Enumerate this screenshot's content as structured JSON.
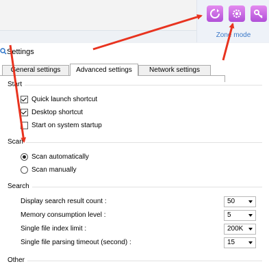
{
  "zone": {
    "label": "Zone mode",
    "buttons": [
      {
        "icon": "refresh-icon"
      },
      {
        "icon": "gear-icon"
      },
      {
        "icon": "key-icon"
      }
    ],
    "button_color": "#c163e6"
  },
  "window": {
    "title": "Settings"
  },
  "tabs": [
    {
      "label": "General settings",
      "active": false
    },
    {
      "label": "Advanced settings",
      "active": true
    },
    {
      "label": "Network settings",
      "active": false
    }
  ],
  "start": {
    "heading": "Start",
    "items": [
      {
        "label": "Quick launch shortcut",
        "checked": true
      },
      {
        "label": "Desktop shortcut",
        "checked": true
      },
      {
        "label": "Start on system startup",
        "checked": false
      }
    ]
  },
  "scan": {
    "heading": "Scan",
    "options": [
      {
        "label": "Scan automatically",
        "selected": true
      },
      {
        "label": "Scan manually",
        "selected": false
      }
    ]
  },
  "search": {
    "heading": "Search",
    "rows": [
      {
        "label": "Display search result count :",
        "value": "50"
      },
      {
        "label": "Memory consumption level :",
        "value": "5"
      },
      {
        "label": "Single file index limit :",
        "value": "200K"
      },
      {
        "label": "Single file parsing timeout (second) :",
        "value": "15"
      }
    ]
  },
  "other": {
    "heading": "Other"
  },
  "annotation_color": "#e8331f"
}
